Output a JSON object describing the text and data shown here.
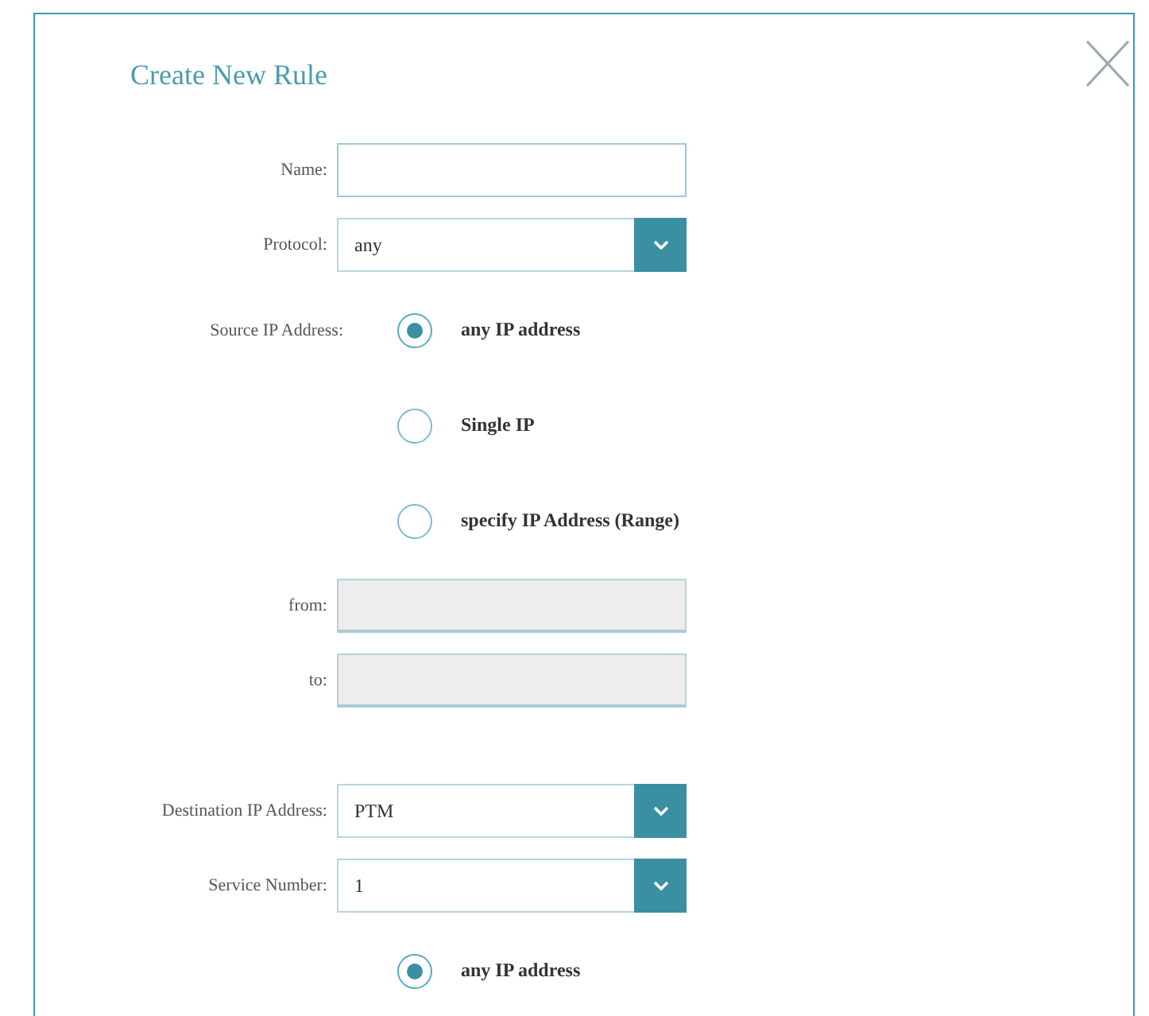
{
  "dialog": {
    "title": "Create New Rule"
  },
  "sections": [
    {
      "rows": [
        {
          "kind": "input",
          "label": "Name:",
          "disabled": false
        },
        {
          "kind": "select",
          "label": "Protocol:",
          "value": "any"
        },
        {
          "kind": "radio",
          "label": "Source IP Address:",
          "option": "any IP address",
          "selected": true
        },
        {
          "kind": "radio",
          "option": "Single IP",
          "selected": false
        },
        {
          "kind": "radio",
          "option": "specify IP Address (Range)",
          "selected": false
        },
        {
          "kind": "input",
          "label": "from:",
          "disabled": true
        },
        {
          "kind": "input",
          "label": "to:",
          "disabled": true
        }
      ]
    },
    {
      "rows": [
        {
          "kind": "select",
          "label": "Destination IP Address:",
          "value": "PTM"
        },
        {
          "kind": "select",
          "label": "Service Number:",
          "value": "1"
        },
        {
          "kind": "radio",
          "option": "any IP address",
          "selected": true
        }
      ]
    }
  ]
}
